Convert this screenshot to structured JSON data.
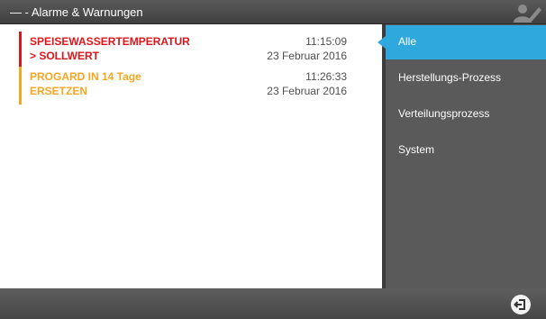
{
  "window": {
    "title": "— - Alarme & Warnungen"
  },
  "alarms": [
    {
      "line1": "SPEISEWASSERTEMPERATUR",
      "line2": "> SOLLWERT",
      "time": "11:15:09",
      "date": "23 Februar 2016",
      "color": "#e0141b"
    },
    {
      "line1": "PROGARD IN 14 Tage",
      "line2": "ERSETZEN",
      "time": "11:26:33",
      "date": "23 Februar 2016",
      "color": "#f5a623"
    }
  ],
  "sidebar": {
    "items": [
      {
        "label": "Alle",
        "active": true
      },
      {
        "label": "Herstellungs-Prozess",
        "active": false
      },
      {
        "label": "Verteilungsprozess",
        "active": false
      },
      {
        "label": "System",
        "active": false
      }
    ]
  },
  "colors": {
    "accent": "#2fa8de",
    "critical": "#e0141b",
    "warning": "#f5a623",
    "sidebar": "#5a5a5a"
  },
  "icons": {
    "user": "user-icon",
    "edit": "pencil-icon",
    "exit": "exit-icon"
  }
}
